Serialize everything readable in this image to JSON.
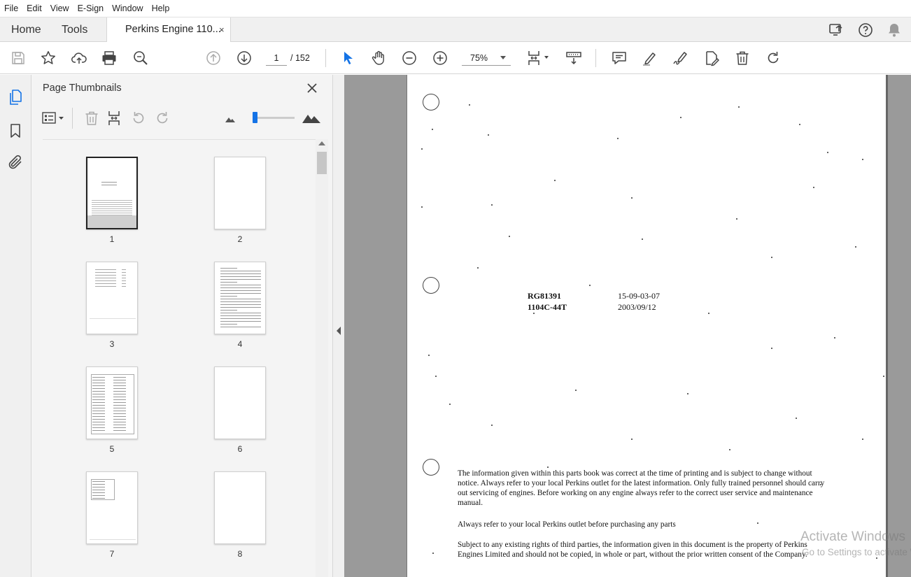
{
  "menu": [
    "File",
    "Edit",
    "View",
    "E-Sign",
    "Window",
    "Help"
  ],
  "tabs": {
    "home": "Home",
    "tools": "Tools",
    "document": "Perkins Engine 110...",
    "close_glyph": "×"
  },
  "toolbar": {
    "current_page": "1",
    "total_pages": "/ 152",
    "zoom": "75%"
  },
  "panel": {
    "title": "Page Thumbnails",
    "slider_value": 0.05,
    "thumbnails": [
      {
        "num": "1",
        "selected": true
      },
      {
        "num": "2",
        "selected": false
      },
      {
        "num": "3",
        "selected": false
      },
      {
        "num": "4",
        "selected": false
      },
      {
        "num": "5",
        "selected": false
      },
      {
        "num": "6",
        "selected": false
      },
      {
        "num": "7",
        "selected": false
      },
      {
        "num": "8",
        "selected": false
      }
    ]
  },
  "document": {
    "code_left_1": "RG81391",
    "code_left_2": "1104C-44T",
    "code_right_1": "15-09-03-07",
    "code_right_2": "2003/09/12",
    "para1": "The information given within this parts book was correct at the time of printing and is subject to change without notice. Always refer to your local Perkins outlet for the latest information. Only fully trained personnel should carry out servicing of engines. Before working on any engine always refer to the correct user service and maintenance manual.",
    "para2": "Always refer to your local Perkins outlet before purchasing any parts",
    "para3": "Subject to any existing rights of third parties, the information given in this document is the property of Perkins Engines Limited and should not be copied, in whole or part, without the prior written consent of the Company."
  },
  "watermark": {
    "line1": "Activate Windows",
    "line2": "Go to Settings to activate Windows."
  },
  "colors": {
    "accent": "#1473e6",
    "toolbar_bg": "#ffffff",
    "panel_bg": "#f4f4f4",
    "doc_bg": "#9a9a9a"
  }
}
